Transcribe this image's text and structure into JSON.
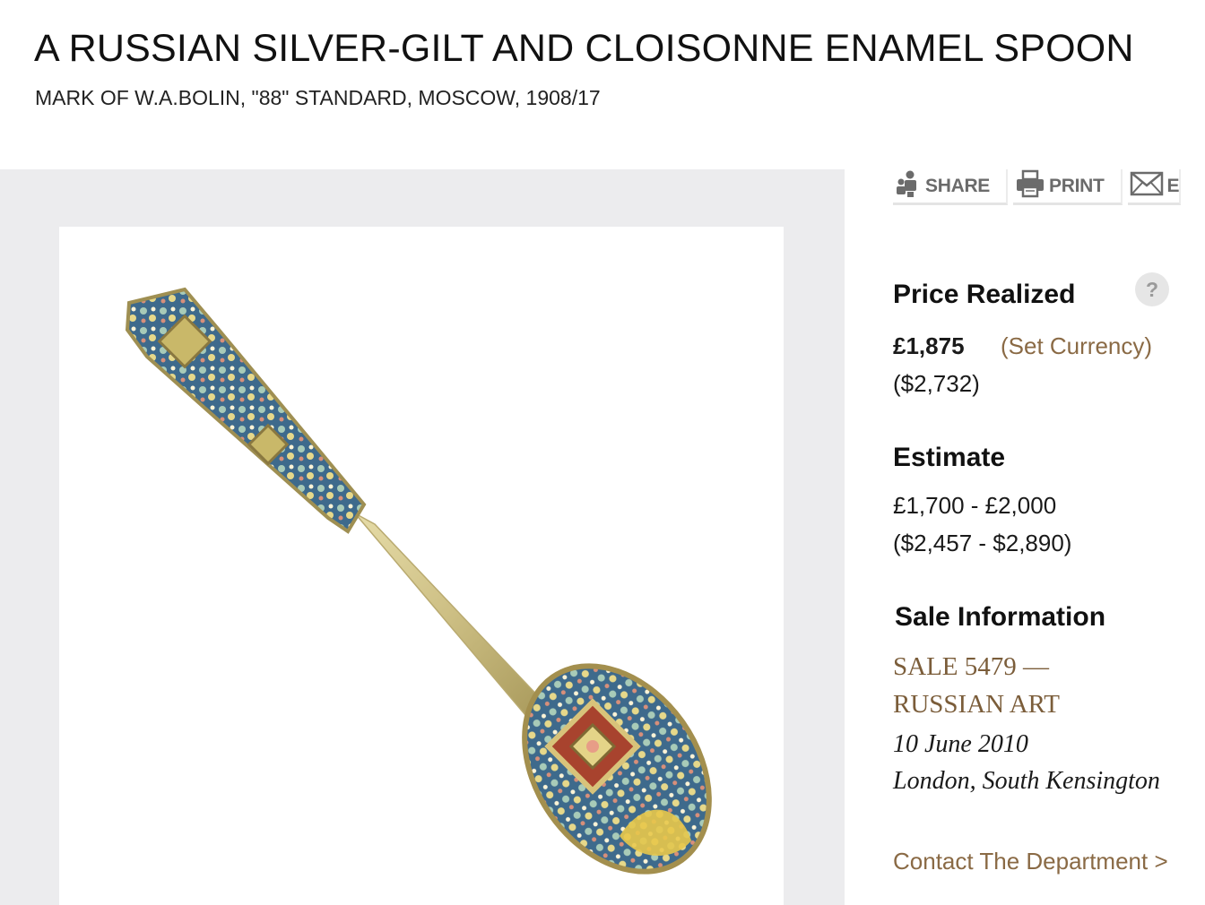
{
  "lot": {
    "title": "A RUSSIAN SILVER-GILT AND CLOISONNE ENAMEL SPOON",
    "subtitle": "MARK OF W.A.BOLIN, \"88\" STANDARD, MOSCOW, 1908/17"
  },
  "toolbar": {
    "share_label": "SHARE",
    "print_label": "PRINT",
    "email_label": "E"
  },
  "price_realized": {
    "heading": "Price Realized",
    "help_symbol": "?",
    "amount_gbp": "£1,875",
    "set_currency_label": "(Set Currency)",
    "amount_usd": "($2,732)"
  },
  "estimate": {
    "heading": "Estimate",
    "range_gbp": "£1,700 - £2,000",
    "range_usd": "($2,457 - $2,890)"
  },
  "sale_information": {
    "heading": "Sale Information",
    "sale_line1": "SALE 5479 —",
    "sale_line2": "RUSSIAN ART",
    "date": "10 June 2010",
    "location": "London, South Kensington"
  },
  "contact_label": "Contact The Department >",
  "icons": {
    "share": "share-people-icon",
    "print": "printer-icon",
    "email": "envelope-icon",
    "help": "help-circle-icon"
  },
  "colors": {
    "panel_bg": "#ececee",
    "link_brown": "#8a6a45",
    "toolbar_text": "#6b6b6b"
  }
}
